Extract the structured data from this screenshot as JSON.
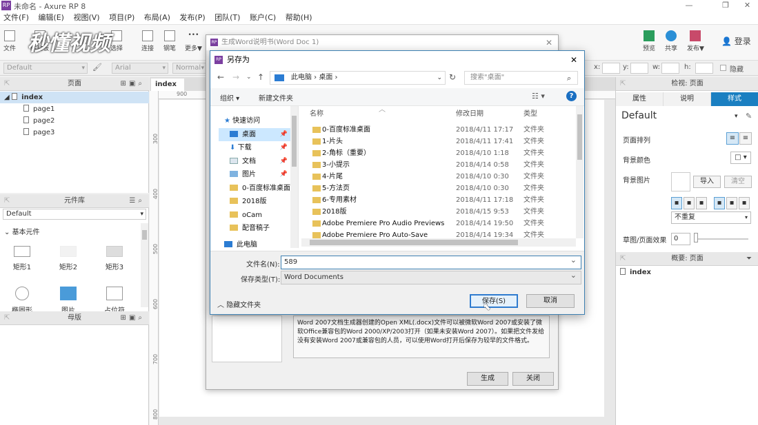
{
  "app": {
    "title": "未命名 - Axure RP 8"
  },
  "menu": [
    "文件(F)",
    "编辑(E)",
    "视图(V)",
    "项目(P)",
    "布局(A)",
    "发布(P)",
    "团队(T)",
    "账户(C)",
    "帮助(H)"
  ],
  "toolbar": {
    "file": "文件",
    "paste": "粘贴板",
    "select": "选择",
    "connect": "连接",
    "pen": "钢笔",
    "more": "更多▼",
    "preview": "预览",
    "share": "共享",
    "publish": "发布▼",
    "login": "登录",
    "watermark": "秒懂视频"
  },
  "styles": {
    "style_select": "Default",
    "font_select": "Arial",
    "weight_select": "Normal",
    "x": "x:",
    "y": "y:",
    "w": "w:",
    "h": "h:",
    "hide": "隐藏"
  },
  "pages": {
    "header": "页面",
    "root": "index",
    "items": [
      "page1",
      "page2",
      "page3"
    ]
  },
  "library": {
    "header": "元件库",
    "select": "Default",
    "group": "基本元件",
    "widgets": [
      "矩形1",
      "矩形2",
      "矩形3",
      "椭圆形",
      "图片",
      "占位符"
    ]
  },
  "masters": {
    "header": "母版"
  },
  "canvas": {
    "tab": "index",
    "ruler_h": [
      "900"
    ],
    "ruler_v": [
      "300",
      "400",
      "500",
      "600",
      "700",
      "800"
    ]
  },
  "inspector": {
    "header": "检视: 页面",
    "tabs": [
      "属性",
      "说明",
      "样式"
    ],
    "style_name": "Default",
    "page_align": "页面排列",
    "bg_color": "背景颜色",
    "bg_image": "背景图片",
    "import": "导入",
    "clear": "清空",
    "repeat": "不重复",
    "sketch": "草图/页面效果",
    "sketch_value": "0",
    "outline_header": "概要: 页面",
    "outline_item": "index"
  },
  "word_dialog": {
    "title": "生成Word说明书(Word Doc 1)",
    "description": "Word 2007文档生成器创建的Open XML(.docx)文件可以被微软Word 2007或安装了微软Office兼容包的Word 2000/XP/2003打开（如果未安装Word 2007）。如果把文件发给没有安装Word 2007或兼容包的人员，可以使用Word打开后保存为较早的文件格式。",
    "generate": "生成",
    "close": "关闭"
  },
  "saveas": {
    "title": "另存为",
    "address": [
      "此电脑",
      "桌面"
    ],
    "search_placeholder": "搜索\"桌面\"",
    "organize": "组织 ▾",
    "new_folder": "新建文件夹",
    "nav": [
      {
        "label": "快速访问"
      },
      {
        "label": "桌面"
      },
      {
        "label": "下载"
      },
      {
        "label": "文档"
      },
      {
        "label": "图片"
      },
      {
        "label": "0-百度标准桌面"
      },
      {
        "label": "2018版"
      },
      {
        "label": "oCam"
      },
      {
        "label": "配音稿子"
      },
      {
        "label": "此电脑"
      }
    ],
    "columns": {
      "name": "名称",
      "date": "修改日期",
      "type": "类型"
    },
    "files": [
      {
        "name": "0-百度标准桌面",
        "date": "2018/4/11 17:17",
        "type": "文件夹"
      },
      {
        "name": "1-片头",
        "date": "2018/4/11 17:41",
        "type": "文件夹"
      },
      {
        "name": "2-角标（重要）",
        "date": "2018/4/10 1:18",
        "type": "文件夹"
      },
      {
        "name": "3-小提示",
        "date": "2018/4/14 0:58",
        "type": "文件夹"
      },
      {
        "name": "4-片尾",
        "date": "2018/4/10 0:30",
        "type": "文件夹"
      },
      {
        "name": "5-方法页",
        "date": "2018/4/10 0:30",
        "type": "文件夹"
      },
      {
        "name": "6-专用素材",
        "date": "2018/4/11 17:18",
        "type": "文件夹"
      },
      {
        "name": "2018版",
        "date": "2018/4/15 9:53",
        "type": "文件夹"
      },
      {
        "name": "Adobe Premiere Pro Audio Previews",
        "date": "2018/4/14 19:50",
        "type": "文件夹"
      },
      {
        "name": "Adobe Premiere Pro Auto-Save",
        "date": "2018/4/14 19:34",
        "type": "文件夹"
      }
    ],
    "filename_label": "文件名(N):",
    "filename_value": "589",
    "filetype_label": "保存类型(T):",
    "filetype_value": "Word Documents",
    "hide_folders": "隐藏文件夹",
    "save": "保存(S)",
    "cancel": "取消"
  }
}
